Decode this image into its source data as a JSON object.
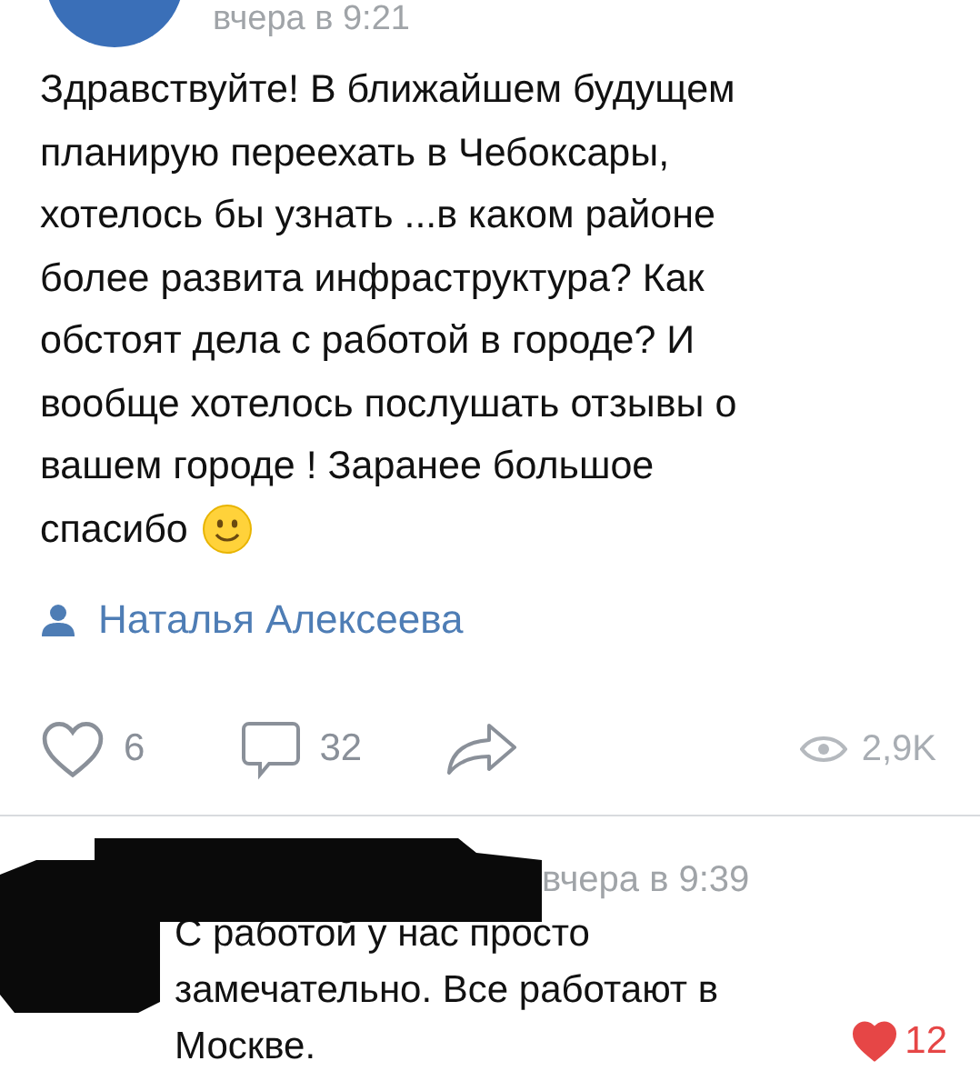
{
  "post": {
    "date": "вчера в 9:21",
    "text_lines": [
      "Здравствуйте! В ближайшем будущем",
      "планирую переехать в Чебоксары,",
      "хотелось бы узнать ...в каком районе",
      "более развита инфраструктура? Как",
      "обстоят дела с работой в городе? И",
      "вообще хотелось послушать отзывы о",
      "вашем городе ! Заранее большое",
      "спасибо"
    ],
    "author": "Наталья Алексеева"
  },
  "actions": {
    "likes": {
      "count": "6",
      "liked": false
    },
    "comments": "32",
    "views": "2,9K"
  },
  "comment": {
    "date": "вчера в 9:39",
    "text": "С работой у нас просто замечательно. Все работают в Москве.",
    "likes": {
      "count": "12",
      "liked": true
    }
  }
}
